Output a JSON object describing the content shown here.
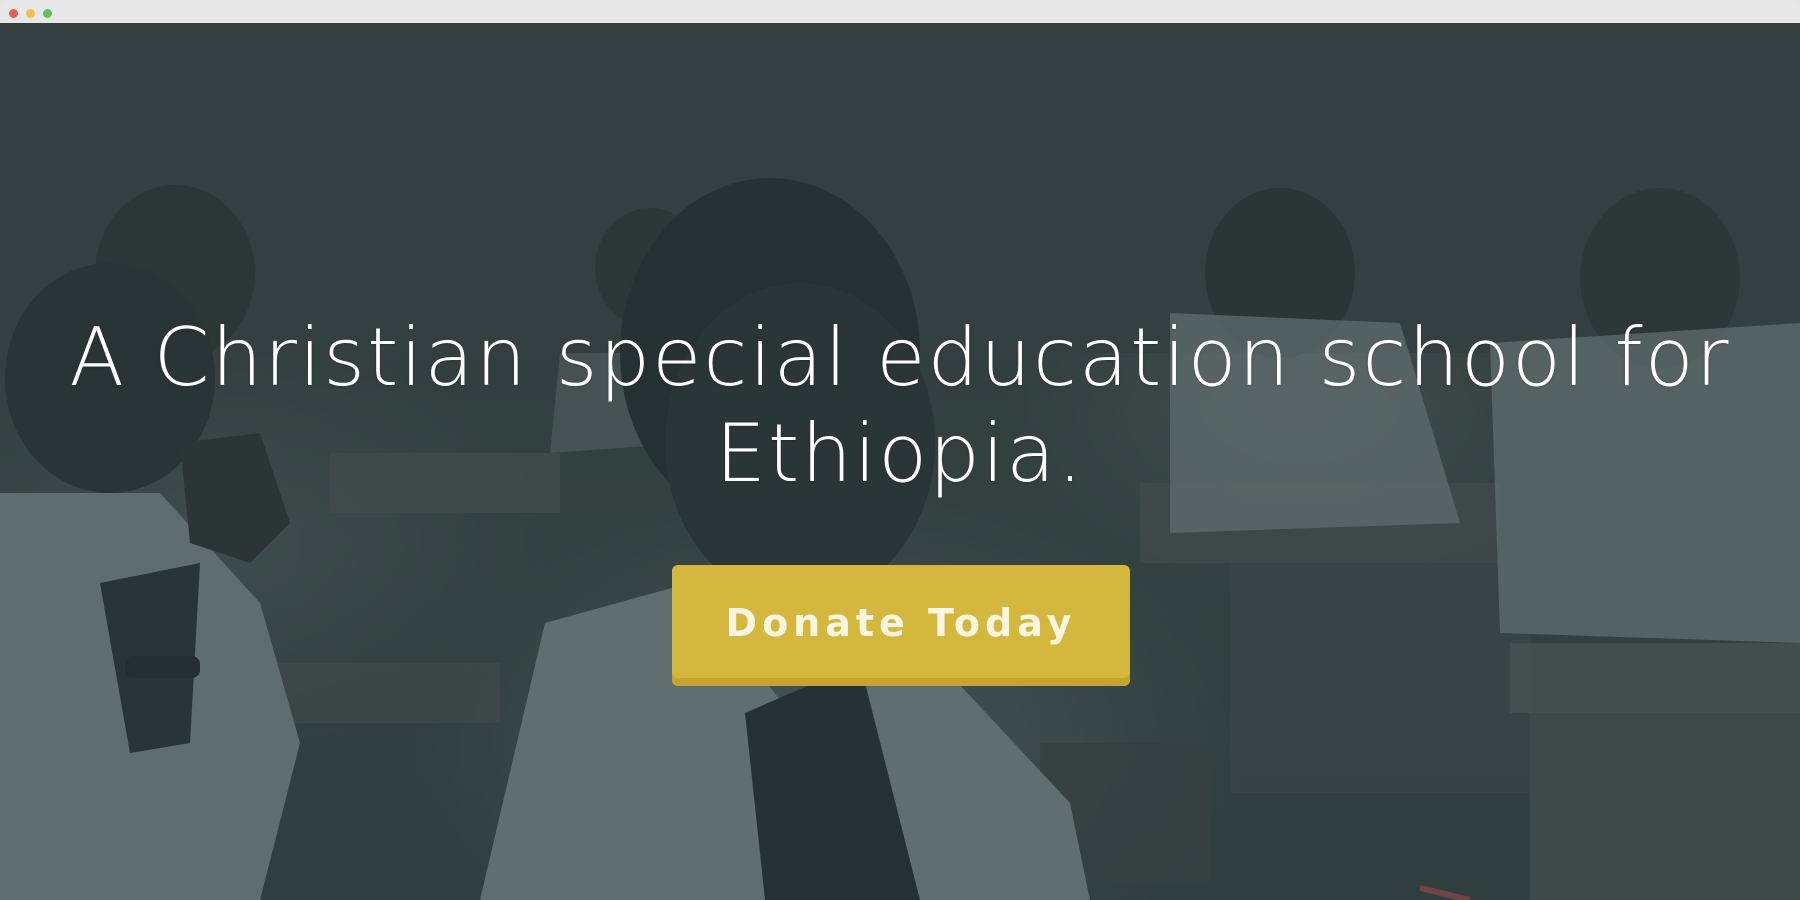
{
  "window": {
    "controls": [
      "close",
      "minimize",
      "maximize"
    ]
  },
  "hero": {
    "title": "A Christian special education school for Ethiopia.",
    "cta_label": "Donate Today",
    "colors": {
      "cta_background": "#d4b83d",
      "cta_text": "#fbf6e2",
      "overlay": "#2c3e40",
      "title": "#ffffff"
    }
  }
}
